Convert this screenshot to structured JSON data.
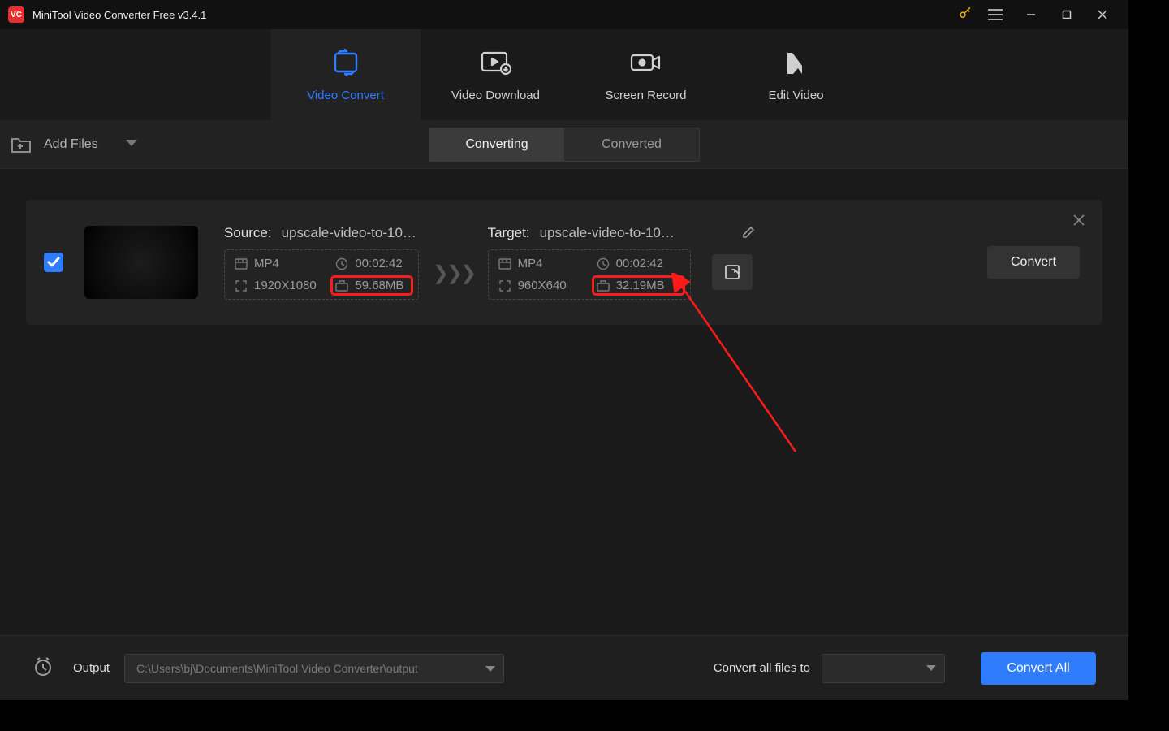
{
  "titlebar": {
    "app_title": "MiniTool Video Converter Free v3.4.1",
    "logo_text": "VC"
  },
  "main_nav": {
    "tabs": [
      {
        "label": "Video Convert"
      },
      {
        "label": "Video Download"
      },
      {
        "label": "Screen Record"
      },
      {
        "label": "Edit Video"
      }
    ]
  },
  "secondary_bar": {
    "add_files_label": "Add Files",
    "tabs": {
      "converting": "Converting",
      "converted": "Converted"
    }
  },
  "item": {
    "source": {
      "label": "Source:",
      "name": "upscale-video-to-108...",
      "format": "MP4",
      "duration": "00:02:42",
      "resolution": "1920X1080",
      "size": "59.68MB"
    },
    "target": {
      "label": "Target:",
      "name": "upscale-video-to-108...",
      "format": "MP4",
      "duration": "00:02:42",
      "resolution": "960X640",
      "size": "32.19MB"
    },
    "convert_label": "Convert"
  },
  "bottom_bar": {
    "output_label": "Output",
    "output_path": "C:\\Users\\bj\\Documents\\MiniTool Video Converter\\output",
    "convert_all_to_label": "Convert all files to",
    "convert_all_label": "Convert All"
  }
}
